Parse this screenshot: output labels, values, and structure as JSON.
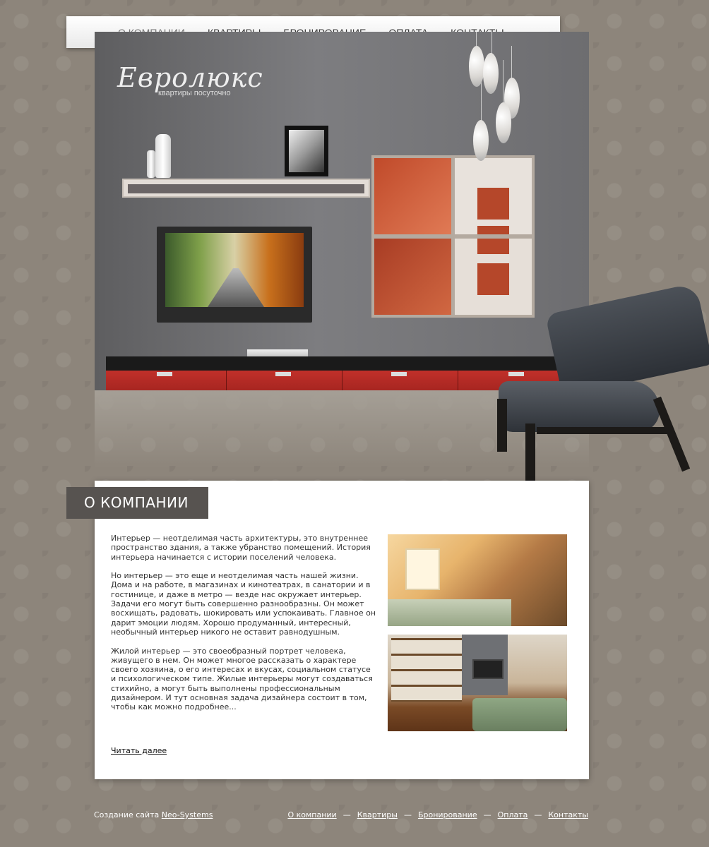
{
  "nav": {
    "items": [
      {
        "label": "О компании",
        "active": true
      },
      {
        "label": "Квартиры",
        "active": false
      },
      {
        "label": "Бронирование",
        "active": false
      },
      {
        "label": "Оплата",
        "active": false
      },
      {
        "label": "Контакты",
        "active": false
      }
    ],
    "separator": "—"
  },
  "brand": {
    "name": "Евролюкс",
    "tagline": "квартиры посуточно"
  },
  "section": {
    "title": "О КОМПАНИИ",
    "paragraphs": [
      "Интерьер — неотделимая часть архитектуры, это внутреннее пространство здания, а также убранство помещений. История интерьера начинается с истории поселений человека.",
      "Но интерьер — это еще и неотделимая часть нашей жизни. Дома и на работе, в магазинах и кинотеатрах, в санатории и в гостинице, и даже в метро — везде нас окружает интерьер. Задачи его могут быть совершенно разнообразны. Он может восхищать, радовать, шокировать или успокаивать. Главное он дарит эмоции людям. Хорошо продуманный, интересный, необычный интерьер никого не оставит равнодушным.",
      "Жилой интерьер — это своеобразный портрет человека, живущего в нем. Он может многое рассказать о характере своего хозяина, о его интересах и вкусах, социальном статусе и психологическом типе. Жилые интерьеры могут создаваться стихийно, а могут быть выполнены профессиональным дизайнером. И тут основная задача дизайнера состоит в том, чтобы как можно подробнее..."
    ],
    "read_more": "Читать далее"
  },
  "footer": {
    "credit_prefix": "Создание сайта",
    "credit_link": "Neo-Systems",
    "nav": [
      "О компании",
      "Квартиры",
      "Бронирование",
      "Оплата",
      "Контакты"
    ],
    "separator": "—"
  },
  "colors": {
    "background": "#8d857b",
    "section_title_bg": "#575350",
    "panel_bg": "#ffffff",
    "accent_red": "#c1302a"
  }
}
